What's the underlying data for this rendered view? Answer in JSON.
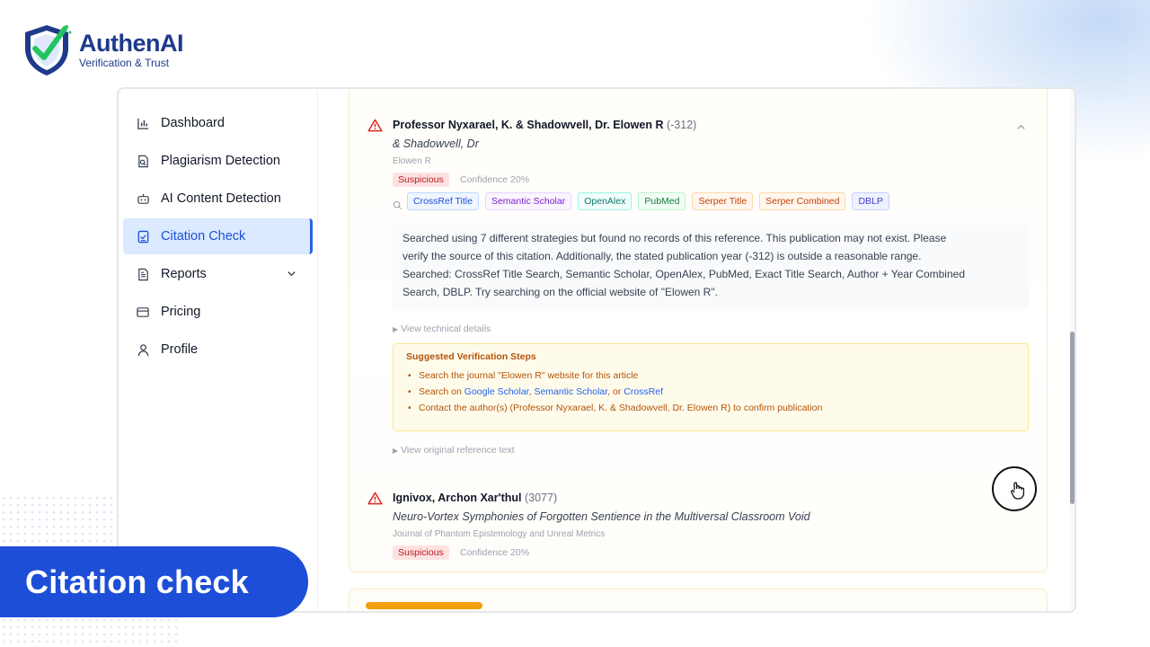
{
  "brand": {
    "name": "AuthenAI",
    "tagline": "Verification & Trust"
  },
  "sidebar": {
    "items": [
      {
        "label": "Dashboard",
        "icon": "bar-chart-icon",
        "active": false
      },
      {
        "label": "Plagiarism Detection",
        "icon": "document-search-icon",
        "active": false
      },
      {
        "label": "AI Content Detection",
        "icon": "robot-icon",
        "active": false
      },
      {
        "label": "Citation Check",
        "icon": "clipboard-check-icon",
        "active": true
      },
      {
        "label": "Reports",
        "icon": "report-icon",
        "active": false,
        "has_dropdown": true
      },
      {
        "label": "Pricing",
        "icon": "credit-card-icon",
        "active": false
      },
      {
        "label": "Profile",
        "icon": "user-icon",
        "active": false
      }
    ]
  },
  "citation1": {
    "authors": "Professor Nyxarael, K. & Shadowvell, Dr. Elowen R",
    "year": "(-312)",
    "title": "& Shadowvell, Dr",
    "journal": "Elowen R",
    "status": "Suspicious",
    "confidence": "Confidence 20%",
    "sources": [
      "CrossRef Title",
      "Semantic Scholar",
      "OpenAlex",
      "PubMed",
      "Serper Title",
      "Serper Combined",
      "DBLP"
    ],
    "message_lines": [
      "Searched using 7 different strategies but found no records of this reference. This publication may not exist. Please",
      "verify the source of this citation. Additionally, the stated publication year (-312) is outside a reasonable range.",
      "Searched: CrossRef Title Search, Semantic Scholar, OpenAlex, PubMed, Exact Title Search, Author + Year Combined",
      "Search, DBLP. Try searching on the official website of \"Elowen R\"."
    ],
    "technical_toggle": "View technical details",
    "steps_title": "Suggested Verification Steps",
    "step1": "Search the journal \"Elowen R\" website for this article",
    "step2_prefix": "Search on ",
    "step2_link1": "Google Scholar",
    "step2_sep1": ", ",
    "step2_link2": "Semantic Scholar",
    "step2_sep2": ", or ",
    "step2_link3": "CrossRef",
    "step3": "Contact the author(s) (Professor Nyxarael, K. & Shadowvell, Dr. Elowen R) to confirm publication",
    "original_toggle": "View original reference text"
  },
  "citation2": {
    "authors": "Ignivox, Archon Xar'thul",
    "year": "(3077)",
    "title": "Neuro-Vortex Symphonies of Forgotten Sentience in the Multiversal Classroom Void",
    "journal": "Journal of Phantom Epistemology and Unreal Metrics",
    "status": "Suspicious",
    "confidence": "Confidence 20%"
  },
  "caption": "Citation check",
  "colors": {
    "accent": "#1d4ed8",
    "warning": "#dc2626",
    "amber": "#b45309"
  }
}
